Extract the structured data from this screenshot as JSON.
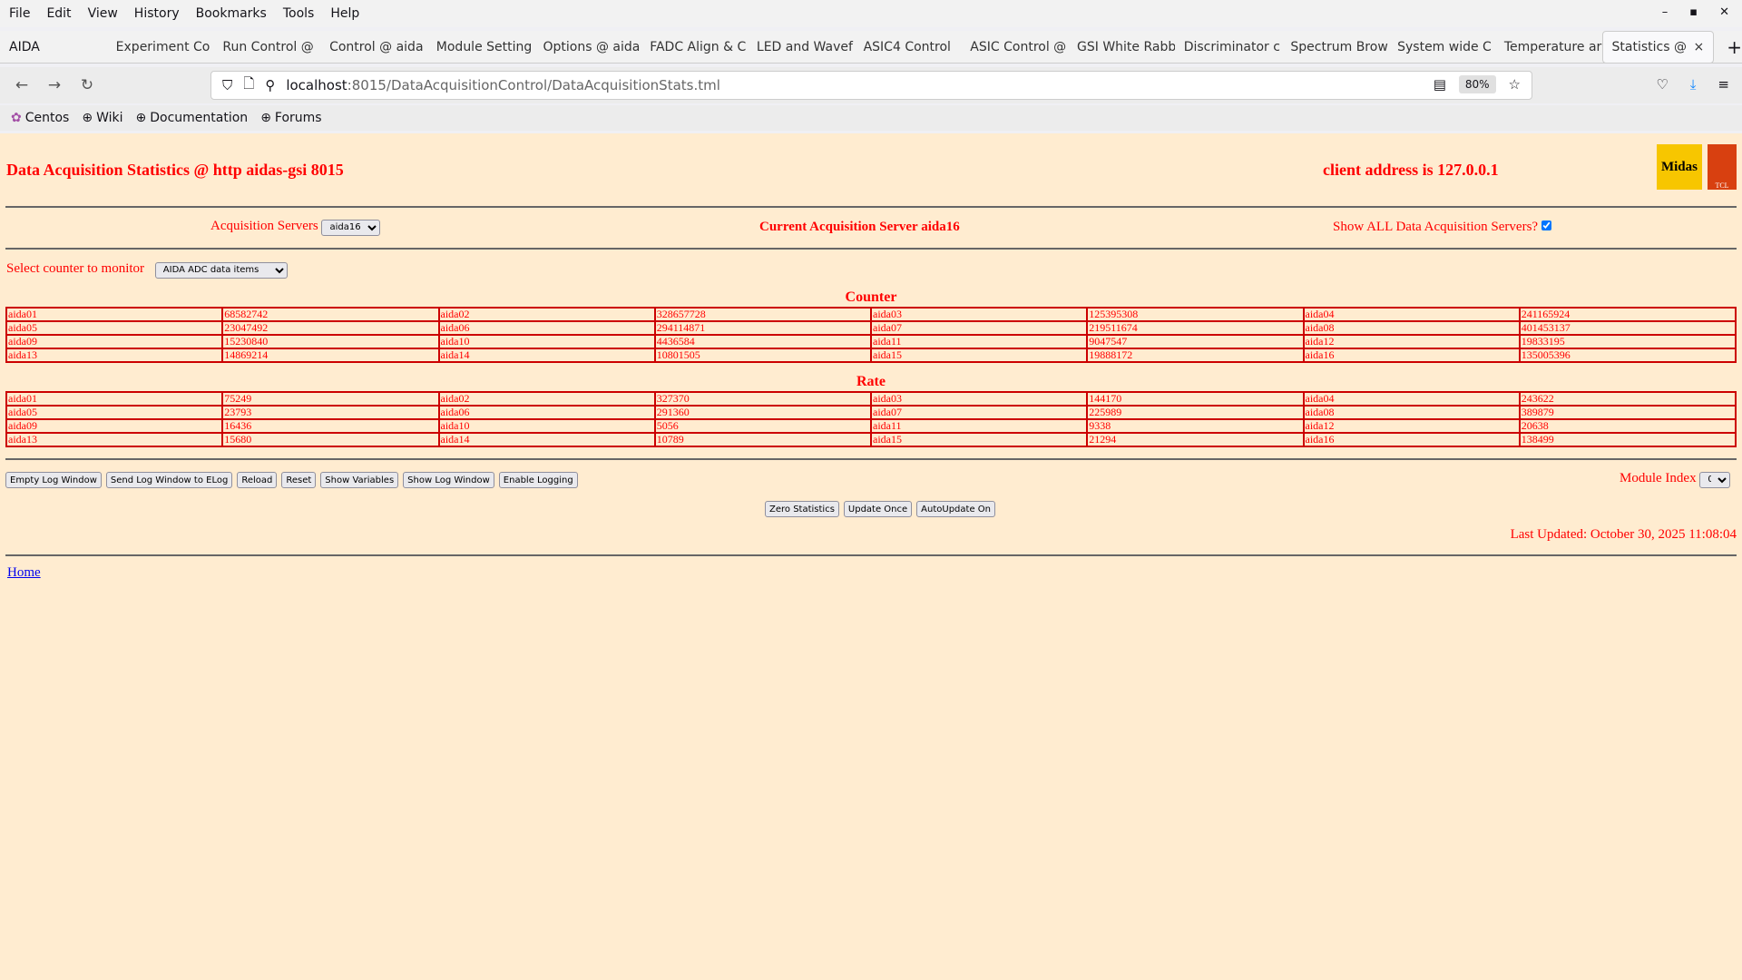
{
  "browser": {
    "menu": [
      "File",
      "Edit",
      "View",
      "History",
      "Bookmarks",
      "Tools",
      "Help"
    ],
    "app_label": "AIDA",
    "tabs": [
      "Experiment Co",
      "Run Control @",
      "Control @ aida",
      "Module Setting",
      "Options @ aida",
      "FADC Align & C",
      "LED and Wavef",
      "ASIC4 Control",
      "ASIC Control @",
      "GSI White Rabb",
      "Discriminator c",
      "Spectrum Brow",
      "System wide C",
      "Temperature ar"
    ],
    "active_tab": "Statistics @",
    "url_host": "localhost",
    "url_path": ":8015/DataAcquisitionControl/DataAcquisitionStats.tml",
    "zoom": "80%",
    "bookmarks": [
      "Centos",
      "Wiki",
      "Documentation",
      "Forums"
    ]
  },
  "page": {
    "title": "Data Acquisition Statistics @ http aidas-gsi 8015",
    "client": "client address is 127.0.0.1",
    "logo_text": "Midas",
    "logo2_text": "TCL",
    "acq_servers_label": "Acquisition Servers",
    "acq_server_value": "aida16",
    "current_server": "Current Acquisition Server aida16",
    "show_all_label": "Show ALL Data Acquisition Servers?",
    "show_all_checked": true,
    "select_counter_label": "Select counter to monitor",
    "select_counter_value": "AIDA ADC data items",
    "counter_heading": "Counter",
    "counter_rows": [
      [
        "aida01",
        "68582742",
        "aida02",
        "328657728",
        "aida03",
        "125395308",
        "aida04",
        "241165924"
      ],
      [
        "aida05",
        "23047492",
        "aida06",
        "294114871",
        "aida07",
        "219511674",
        "aida08",
        "401453137"
      ],
      [
        "aida09",
        "15230840",
        "aida10",
        "4436584",
        "aida11",
        "9047547",
        "aida12",
        "19833195"
      ],
      [
        "aida13",
        "14869214",
        "aida14",
        "10801505",
        "aida15",
        "19888172",
        "aida16",
        "135005396"
      ]
    ],
    "rate_heading": "Rate",
    "rate_rows": [
      [
        "aida01",
        "75249",
        "aida02",
        "327370",
        "aida03",
        "144170",
        "aida04",
        "243622"
      ],
      [
        "aida05",
        "23793",
        "aida06",
        "291360",
        "aida07",
        "225989",
        "aida08",
        "389879"
      ],
      [
        "aida09",
        "16436",
        "aida10",
        "5056",
        "aida11",
        "9338",
        "aida12",
        "20638"
      ],
      [
        "aida13",
        "15680",
        "aida14",
        "10789",
        "aida15",
        "21294",
        "aida16",
        "138499"
      ]
    ],
    "buttons": [
      "Empty Log Window",
      "Send Log Window to ELog",
      "Reload",
      "Reset",
      "Show Variables",
      "Show Log Window",
      "Enable Logging"
    ],
    "module_index_label": "Module Index",
    "module_index_value": "0",
    "buttons2": [
      "Zero Statistics",
      "Update Once",
      "AutoUpdate On"
    ],
    "last_updated": "Last Updated: October 30, 2025 11:08:04",
    "home_link": "Home"
  },
  "colors": {
    "page_bg": "#ffecd0",
    "text": "#ff0000",
    "table_border": "#cc0000"
  }
}
